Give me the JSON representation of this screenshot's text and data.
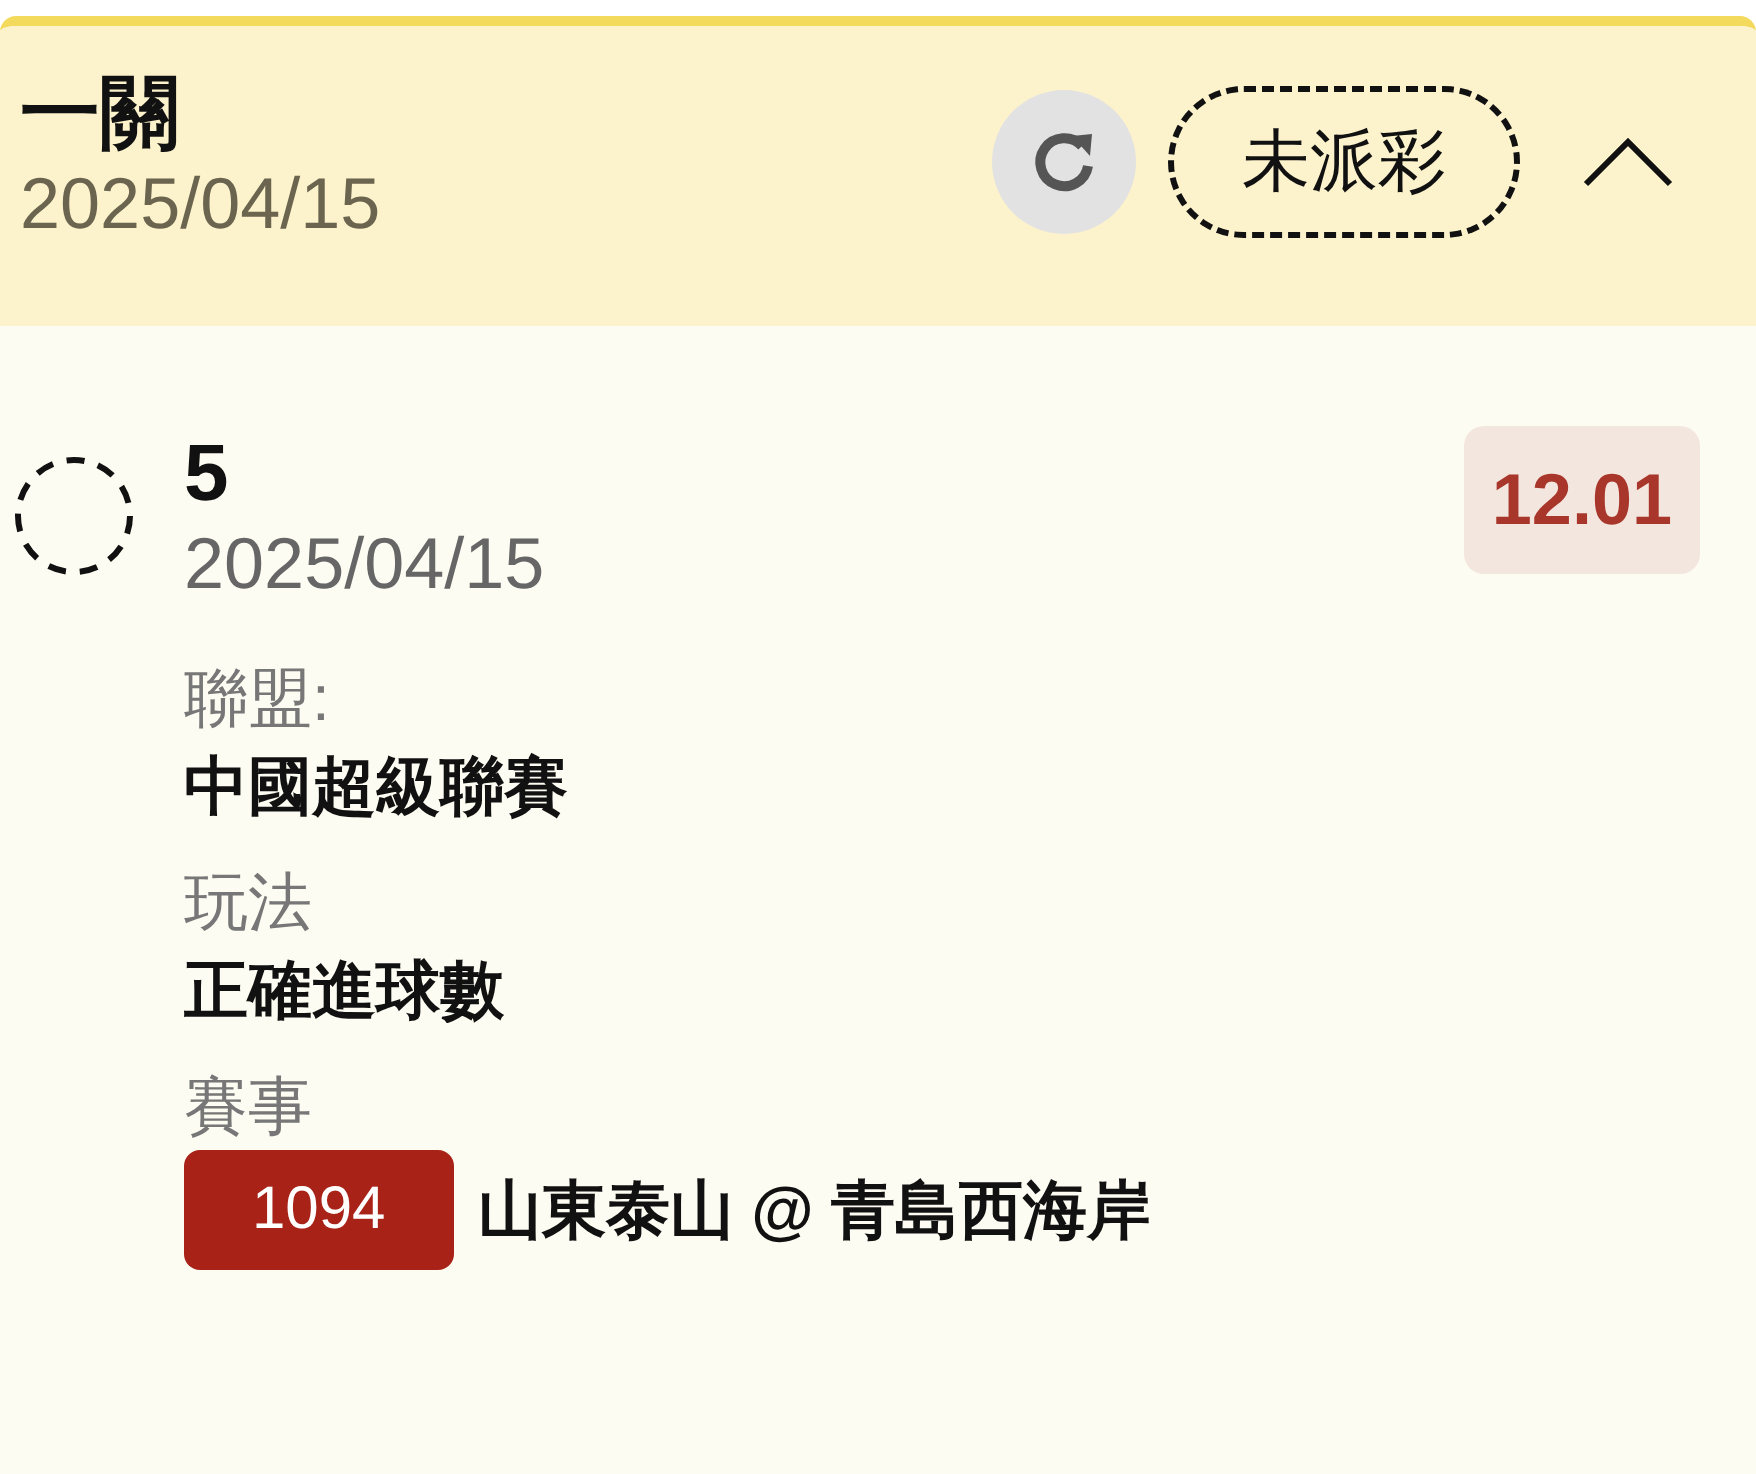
{
  "header": {
    "title": "一關",
    "date": "2025/04/15",
    "status": "未派彩",
    "expanded": true
  },
  "bet": {
    "settled": false,
    "selection": "5",
    "date": "2025/04/15",
    "odds": "12.01",
    "fields": [
      {
        "label": "聯盟:",
        "value": "中國超級聯賽"
      },
      {
        "label": "玩法",
        "value": "正確進球數"
      },
      {
        "label": "賽事",
        "match_no": "1094",
        "value": "山東泰山 @ 青島西海岸"
      }
    ]
  }
}
